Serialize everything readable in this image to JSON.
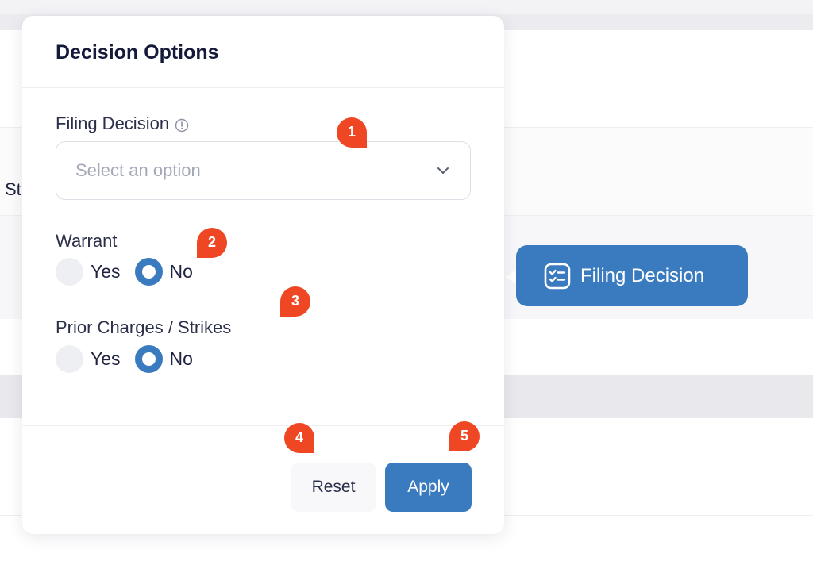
{
  "background": {
    "partial_text": "St",
    "filing_button_label": "Filing Decision"
  },
  "panel": {
    "title": "Decision Options",
    "filing_decision": {
      "label": "Filing Decision",
      "placeholder": "Select an option"
    },
    "warrant": {
      "label": "Warrant",
      "options": [
        "Yes",
        "No"
      ],
      "selected": "No"
    },
    "prior_charges": {
      "label": "Prior Charges / Strikes",
      "options": [
        "Yes",
        "No"
      ],
      "selected": "No"
    },
    "buttons": {
      "reset": "Reset",
      "apply": "Apply"
    }
  },
  "markers": [
    "1",
    "2",
    "3",
    "4",
    "5"
  ],
  "colors": {
    "accent": "#3a7bc0",
    "marker": "#ef4723"
  }
}
